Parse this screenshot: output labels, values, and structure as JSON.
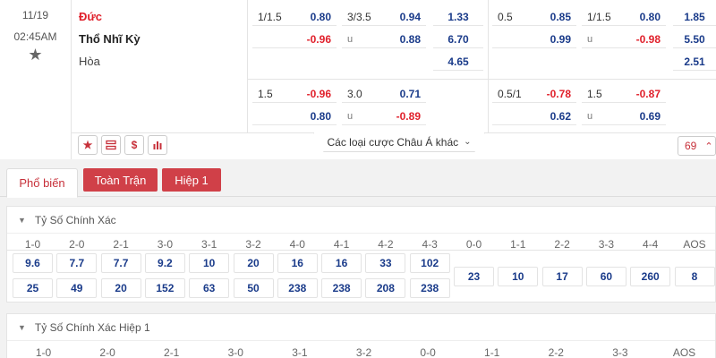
{
  "match": {
    "date": "11/19",
    "time": "02:45AM",
    "home": "Đức",
    "away": "Thổ Nhĩ Kỳ",
    "draw": "Hòa"
  },
  "odds": {
    "r1": {
      "hcap_line": "1/1.5",
      "hcap_home": "0.80",
      "hcap_away": "-0.96",
      "ou_line": "3/3.5",
      "ou_over": "0.94",
      "ou_under_label": "u",
      "ou_under": "0.88",
      "x12_home": "1.33",
      "x12_away": "6.70",
      "x12_draw": "4.65",
      "h1_hcap_line": "0.5",
      "h1_hcap_home": "0.85",
      "h1_hcap_away": "0.99",
      "h1_ou_line": "1/1.5",
      "h1_ou_over": "0.80",
      "h1_ou_under_label": "u",
      "h1_ou_under": "-0.98",
      "h1_x12_home": "1.85",
      "h1_x12_away": "5.50",
      "h1_x12_draw": "2.51"
    },
    "r2": {
      "hcap_line": "1.5",
      "hcap_home": "-0.96",
      "hcap_away": "0.80",
      "ou_line": "3.0",
      "ou_over": "0.71",
      "ou_under_label": "u",
      "ou_under": "-0.89",
      "h1_hcap_line": "0.5/1",
      "h1_hcap_home": "-0.78",
      "h1_hcap_away": "0.62",
      "h1_ou_line": "1.5",
      "h1_ou_over": "-0.87",
      "h1_ou_under_label": "u",
      "h1_ou_under": "0.69"
    }
  },
  "more_markets": "Các loại cược Châu Á khác",
  "market_count": "69",
  "tabs": [
    "Phổ biến",
    "Toàn Trận",
    "Hiệp 1"
  ],
  "correct_score": {
    "title": "Tỷ Số Chính Xác",
    "headers": [
      "1-0",
      "2-0",
      "2-1",
      "3-0",
      "3-1",
      "3-2",
      "4-0",
      "4-1",
      "4-2",
      "4-3",
      "0-0",
      "1-1",
      "2-2",
      "3-3",
      "4-4",
      "AOS"
    ],
    "home_row": [
      "9.6",
      "7.7",
      "7.7",
      "9.2",
      "10",
      "20",
      "16",
      "16",
      "33",
      "102"
    ],
    "away_row": [
      "25",
      "49",
      "20",
      "152",
      "63",
      "50",
      "238",
      "238",
      "208",
      "238"
    ],
    "draw_row": [
      "23",
      "10",
      "17",
      "60",
      "260",
      "8"
    ]
  },
  "correct_score_h1": {
    "title": "Tỷ Số Chính Xác Hiệp 1",
    "headers": [
      "1-0",
      "2-0",
      "2-1",
      "3-0",
      "3-1",
      "3-2",
      "0-0",
      "1-1",
      "2-2",
      "3-3",
      "AOS"
    ]
  },
  "colors": {
    "accent": "#c7303a",
    "home_red": "#e0202b",
    "odd_blue": "#1a3b8a"
  },
  "icons": [
    "star-icon",
    "favorite-star-icon",
    "list-icon",
    "dollar-icon",
    "bar-chart-icon",
    "chevron-down-icon",
    "chevron-up-icon",
    "triangle-down-icon"
  ]
}
